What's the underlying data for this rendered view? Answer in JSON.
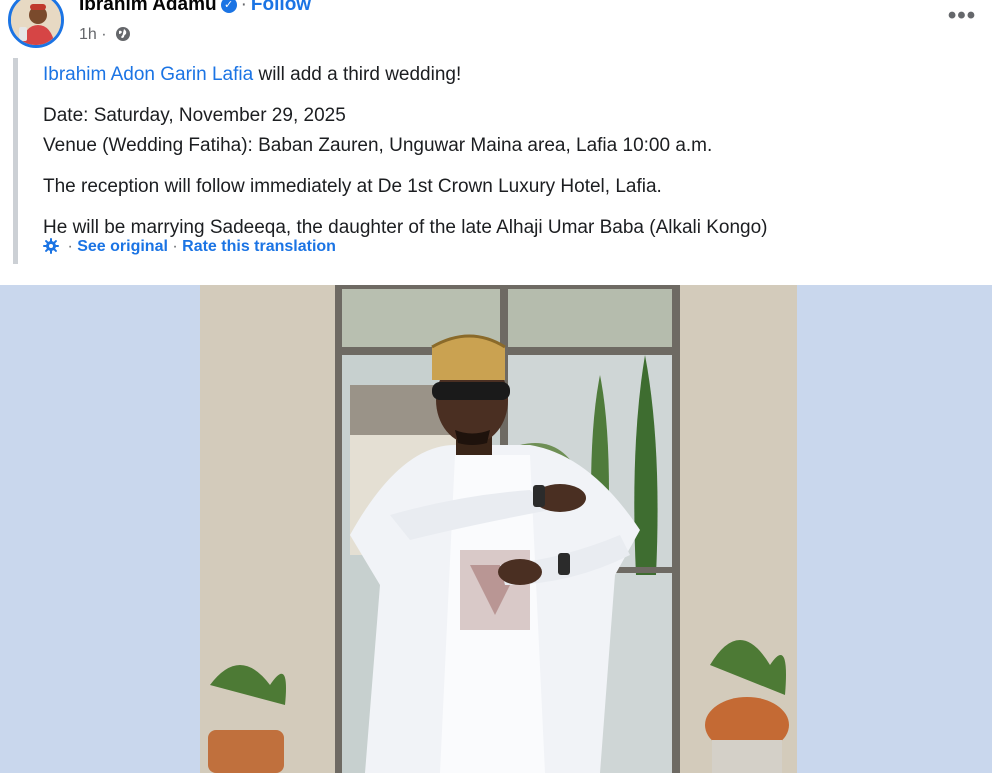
{
  "post": {
    "author": "Ibrahim Adamu",
    "follow_label": "Follow",
    "separator": "·",
    "time": "1h ·",
    "more_label": "•••"
  },
  "content": {
    "mention": "Ibrahim Adon Garin Lafia",
    "intro_rest": " will add a third wedding!",
    "date": "Date: Saturday, November 29, 2025",
    "venue": "Venue (Wedding Fatiha): Baban Zauren, Unguwar Maina area, Lafia 10:00 a.m.",
    "reception": "The reception will follow immediately at De 1st Crown Luxury Hotel, Lafia.",
    "marriage": "He will be marrying Sadeeqa, the daughter of the late Alhaji Umar Baba (Alkali Kongo)"
  },
  "translation": {
    "sep1": " · ",
    "see_original": "See original",
    "sep2": " · ",
    "rate": "Rate this translation"
  },
  "icons": {
    "verified": "verified-badge-icon",
    "globe": "globe-icon",
    "gear": "gear-icon",
    "more": "more-options-icon"
  },
  "colors": {
    "link": "#1b74e4",
    "secondary_text": "#65676b",
    "photo_background": "#c9d7ed"
  }
}
